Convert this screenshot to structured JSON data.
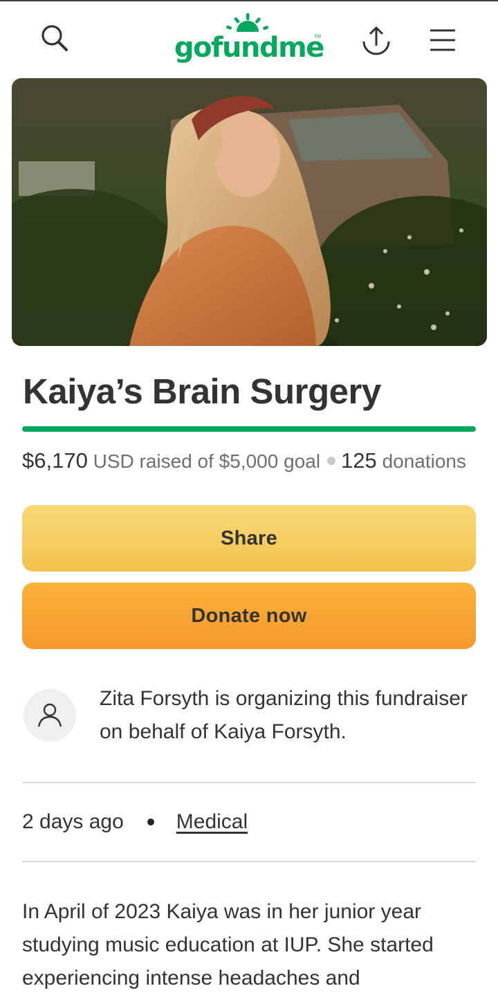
{
  "header": {
    "logo_text": "gofundme",
    "logo_tm": "TM",
    "icons": [
      "search-icon",
      "share-upload-icon",
      "menu-icon"
    ]
  },
  "campaign": {
    "title": "Kaiya’s Brain Surgery",
    "progress_fraction": 1.0,
    "raised_amount": "$6,170",
    "raised_currency_label": "USD raised of $5,000 goal",
    "donation_count": "125",
    "donation_label": "donations"
  },
  "actions": {
    "share_label": "Share",
    "donate_label": "Donate now"
  },
  "organizer": {
    "text": "Zita Forsyth is organizing this fundraiser on behalf of Kaiya Forsyth."
  },
  "meta": {
    "posted": "2 days ago",
    "category": "Medical"
  },
  "story": {
    "text": "In April of 2023 Kaiya was in her junior year studying music education at IUP. She started experiencing intense headaches and"
  },
  "colors": {
    "brand_green": "#02a95c",
    "share_button": "#f5cc5d",
    "donate_button": "#f8a433",
    "text": "#333333"
  }
}
